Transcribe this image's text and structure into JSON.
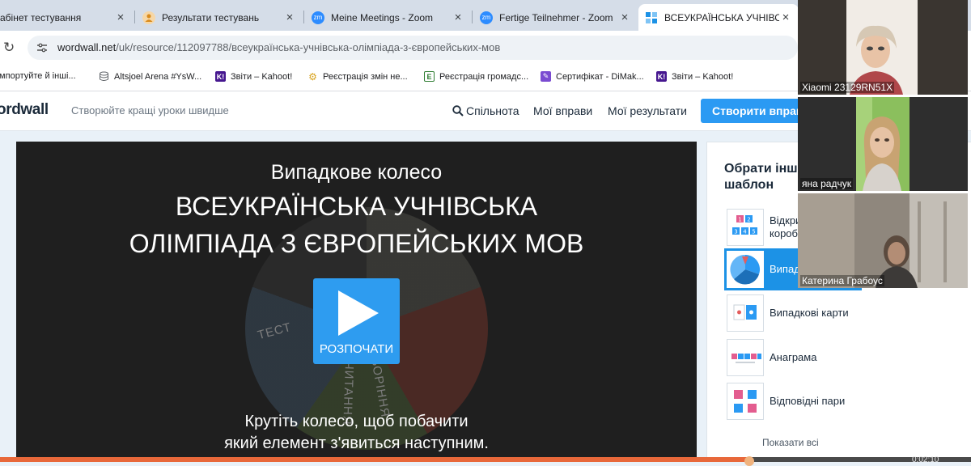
{
  "browser": {
    "tabs": [
      {
        "label": "абінет тестування",
        "icon": "document-icon",
        "color": "#5f6368"
      },
      {
        "label": "Результати тестувань",
        "icon": "person-icon",
        "color": "#f2a33a"
      },
      {
        "label": "Meine Meetings - Zoom",
        "icon": "zoom-icon",
        "color": "#2d8cff"
      },
      {
        "label": "Fertige Teilnehmer - Zoom",
        "icon": "zoom-icon",
        "color": "#2d8cff"
      },
      {
        "label": "ВСЕУКРАЇНСЬКА УЧНІВСЬКА",
        "icon": "wordwall-icon",
        "color": "#1c92e6"
      }
    ],
    "url_host": "wordwall.net",
    "url_path": "/uk/resource/112097788/всеукраїнська-учнівська-олімпіада-з-європейських-мов",
    "bookmarks": [
      {
        "label": "Імпортуйте й інші...",
        "icon": "folder-icon"
      },
      {
        "label": "Altsjoel Arena #YsW...",
        "icon": "database-icon"
      },
      {
        "label": "Звіти – Kahoot!",
        "icon": "kahoot-icon"
      },
      {
        "label": "Реєстрація змін не...",
        "icon": "gear-icon"
      },
      {
        "label": "Реєстрація громадс...",
        "icon": "register-icon"
      },
      {
        "label": "Сертифікат - DiMak...",
        "icon": "certificate-icon"
      },
      {
        "label": "Звіти – Kahoot!",
        "icon": "kahoot-icon"
      }
    ]
  },
  "wordwall": {
    "logo": "ordwall",
    "tagline": "Створюйте кращі уроки швидше",
    "nav": {
      "community": "Спільнота",
      "my_activities": "Мої вправи",
      "my_results": "Мої результати",
      "create": "Створити вправ"
    },
    "game": {
      "template_name": "Випадкове колесо",
      "title_line1": "ВСЕУКРАЇНСЬКА УЧНІВСЬКА",
      "title_line2": "ОЛІМПІАДА З ЄВРОПЕЙСЬКИХ МОВ",
      "start": "РОЗПОЧАТИ",
      "instruction_line1": "Крутіть колесо, щоб побачити",
      "instruction_line2": "який елемент з'явиться наступним.",
      "wheel_words": [
        "ТЕСТ",
        "ГОВОРІННЯ",
        "ЧИТАННЯ"
      ]
    },
    "sidebar": {
      "title": "Обрати інш\nшаблон",
      "templates": [
        {
          "label": "Відкри\nкороб",
          "selected": false
        },
        {
          "label": "Випад",
          "selected": true
        },
        {
          "label": "Випадкові карти",
          "selected": false
        },
        {
          "label": "Анаграма",
          "selected": false
        },
        {
          "label": "Відповідні пари",
          "selected": false
        }
      ],
      "show_all": "Показати всі"
    }
  },
  "video": {
    "participants": [
      {
        "name": "Xiaomi 23129RN51X"
      },
      {
        "name": "яна радчук"
      },
      {
        "name": "Катерина Грабоус"
      }
    ]
  },
  "playback": {
    "progress": 0.77,
    "time": "0:02:10"
  }
}
